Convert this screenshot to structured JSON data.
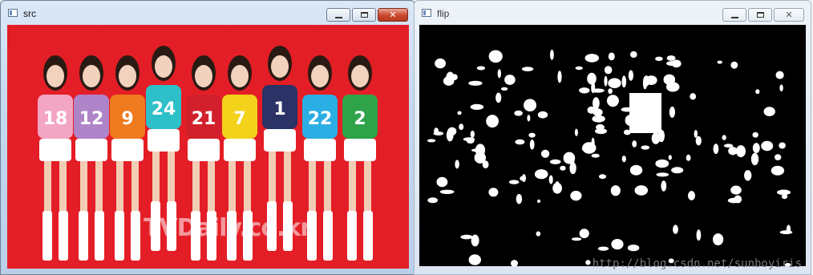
{
  "windows": {
    "src": {
      "title": "src",
      "jersey_numbers": [
        "18",
        "12",
        "9",
        "24",
        "21",
        "7",
        "1",
        "22",
        "2"
      ]
    },
    "flip": {
      "title": "flip"
    }
  },
  "controls": {
    "minimize_icon": "minimize-icon",
    "maximize_icon": "maximize-icon",
    "close_icon": "close-icon",
    "close_glyph": "✕"
  },
  "watermark": {
    "tv_logo": "TVDaily.co.kr",
    "url": "http://blog.csdn.net/sunboyiris"
  },
  "colors": {
    "src_background": "#e41e26",
    "flip_background": "#000000",
    "shirts": [
      "#f3a6c4",
      "#b084c9",
      "#f07a1f",
      "#2ec0c8",
      "#d1202b",
      "#f2d21b",
      "#2a3266",
      "#2aaee3",
      "#2ea34a"
    ]
  }
}
